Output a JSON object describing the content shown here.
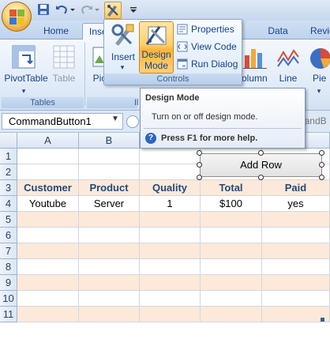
{
  "ribbon_tabs": [
    "Home",
    "Inse",
    "Data",
    "Revie"
  ],
  "ribbon": {
    "groups": {
      "tables_label": "Tables",
      "illustrations_label": "Il",
      "controls_label": "Controls"
    },
    "buttons": {
      "pivottable": "PivotTable",
      "table": "Table",
      "picture": "Pic",
      "column": "olumn",
      "line": "Line",
      "pie": "Pie"
    },
    "controls": {
      "insert": "Insert",
      "design_mode_line1": "Design",
      "design_mode_line2": "Mode",
      "properties": "Properties",
      "view_code": "View Code",
      "run_dialog": "Run Dialog"
    }
  },
  "tooltip": {
    "title": "Design Mode",
    "description": "Turn on or off design mode.",
    "help": "Press F1 for more help."
  },
  "formula_bar": {
    "name_box": "CommandButton1",
    "formula": "=EMBED(\"Forms.CommandB"
  },
  "sheet": {
    "columns": [
      "A",
      "B",
      "C",
      "D",
      "E"
    ],
    "rows": [
      "1",
      "2",
      "3",
      "4",
      "5",
      "6",
      "7",
      "8",
      "9",
      "10",
      "11"
    ],
    "header_row": [
      "Customer",
      "Product",
      "Quality",
      "Total",
      "Paid"
    ],
    "data_row": [
      "Youtube",
      "Server",
      "1",
      "$100",
      "yes"
    ]
  },
  "command_button": {
    "label": "Add Row"
  },
  "colors": {
    "band": "#fde9d9",
    "header_text": "#1f497d",
    "accent": "#ffc85b"
  },
  "icons": [
    "office-button-icon",
    "save-icon",
    "undo-icon",
    "redo-icon",
    "design-mode-icon",
    "insert-controls-icon",
    "properties-icon",
    "view-code-icon",
    "run-dialog-icon",
    "pivottable-icon",
    "table-icon",
    "column-chart-icon",
    "line-chart-icon",
    "pie-chart-icon",
    "help-icon"
  ]
}
